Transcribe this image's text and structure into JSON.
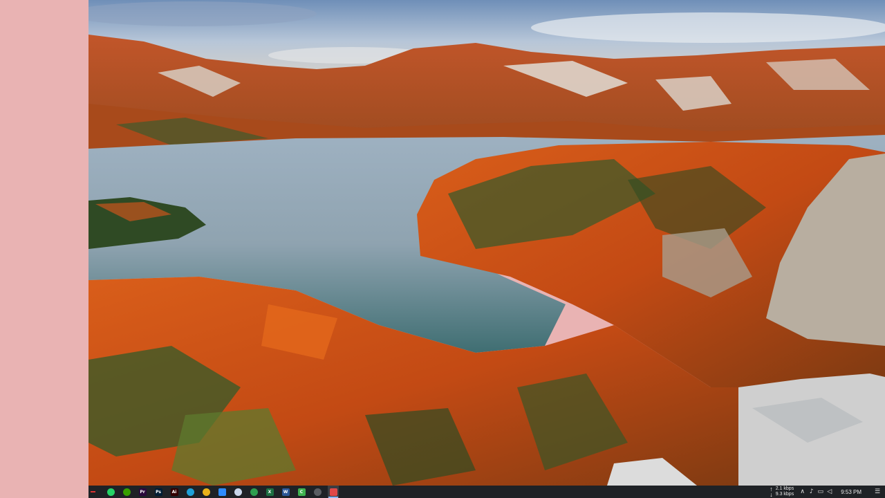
{
  "desktop": {
    "wallpaper": "autumn-lake-landscape",
    "accent_color": "#e9b3b3"
  },
  "taskbar": {
    "start_icon": "windows-start-icon",
    "apps": [
      {
        "name": "whatsapp-icon",
        "glyph": "",
        "color": "#25d366",
        "round": true
      },
      {
        "name": "upwork-icon",
        "glyph": "",
        "color": "#37a000",
        "round": true
      },
      {
        "name": "premiere-icon",
        "glyph": "Pr",
        "color": "#2a0a3c"
      },
      {
        "name": "photoshop-icon",
        "glyph": "Ps",
        "color": "#001d34"
      },
      {
        "name": "illustrator-icon",
        "glyph": "Ai",
        "color": "#330000"
      },
      {
        "name": "edge-icon",
        "glyph": "",
        "color": "#1fa0d8",
        "round": true
      },
      {
        "name": "chrome-icon",
        "glyph": "",
        "color": "#e8b21a",
        "round": true
      },
      {
        "name": "zoom-icon",
        "glyph": "",
        "color": "#2d8cff"
      },
      {
        "name": "browser-icon",
        "glyph": "",
        "color": "#c9d6ea",
        "round": true
      },
      {
        "name": "maps-icon",
        "glyph": "",
        "color": "#2e9e4f",
        "round": true
      },
      {
        "name": "excel-icon",
        "glyph": "X",
        "color": "#1d6f42"
      },
      {
        "name": "word-icon",
        "glyph": "W",
        "color": "#2b5797"
      },
      {
        "name": "camtasia-icon",
        "glyph": "C",
        "color": "#3fb24f"
      },
      {
        "name": "settings-icon",
        "glyph": "",
        "color": "#5a5d62",
        "round": true
      },
      {
        "name": "recorder-icon",
        "glyph": "",
        "color": "#e04848",
        "active": true
      }
    ],
    "network": {
      "up": "2.1 kbps",
      "down": "9.3 kbps"
    },
    "tray_icons": [
      {
        "name": "show-hidden-icons-chevron-icon",
        "glyph": "∧"
      },
      {
        "name": "microphone-icon",
        "glyph": "♪"
      },
      {
        "name": "network-icon",
        "glyph": "▭"
      },
      {
        "name": "volume-icon",
        "glyph": "◁"
      }
    ],
    "clock": "9:53 PM",
    "notification_icon": "☰"
  }
}
